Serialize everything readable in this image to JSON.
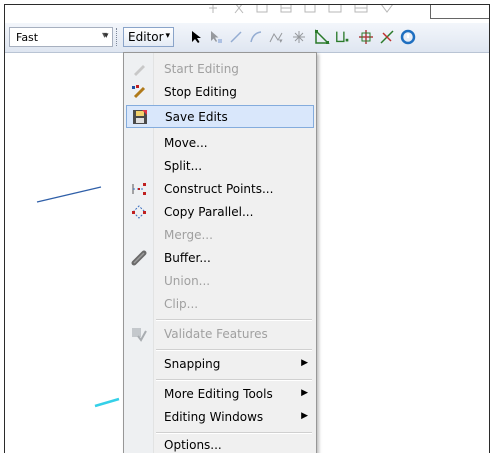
{
  "toolbar": {
    "mode_value": "Fast",
    "editor_label": "Editor"
  },
  "menu": {
    "items": [
      {
        "label": "Start Editing",
        "enabled": false,
        "icon": "pencil-icon"
      },
      {
        "label": "Stop Editing",
        "enabled": true,
        "icon": "stop-editing-icon"
      },
      {
        "label": "Save Edits",
        "enabled": true,
        "icon": "save-icon",
        "highlighted": true
      },
      {
        "label": "Move...",
        "enabled": true
      },
      {
        "label": "Split...",
        "enabled": true
      },
      {
        "label": "Construct Points...",
        "enabled": true,
        "icon": "construct-points-icon"
      },
      {
        "label": "Copy Parallel...",
        "enabled": true,
        "icon": "copy-parallel-icon"
      },
      {
        "label": "Merge...",
        "enabled": false
      },
      {
        "label": "Buffer...",
        "enabled": true,
        "icon": "buffer-icon"
      },
      {
        "label": "Union...",
        "enabled": false
      },
      {
        "label": "Clip...",
        "enabled": false
      },
      {
        "label": "Validate Features",
        "enabled": false,
        "icon": "validate-icon"
      },
      {
        "label": "Snapping",
        "enabled": true,
        "submenu": true
      },
      {
        "label": "More Editing Tools",
        "enabled": true,
        "submenu": true
      },
      {
        "label": "Editing Windows",
        "enabled": true,
        "submenu": true
      },
      {
        "label": "Options...",
        "enabled": true
      }
    ]
  },
  "colors": {
    "highlight_bg": "#d9e7fb",
    "highlight_border": "#84acdd",
    "line_blue": "#2f5fa8",
    "line_cyan": "#35d0e8"
  }
}
